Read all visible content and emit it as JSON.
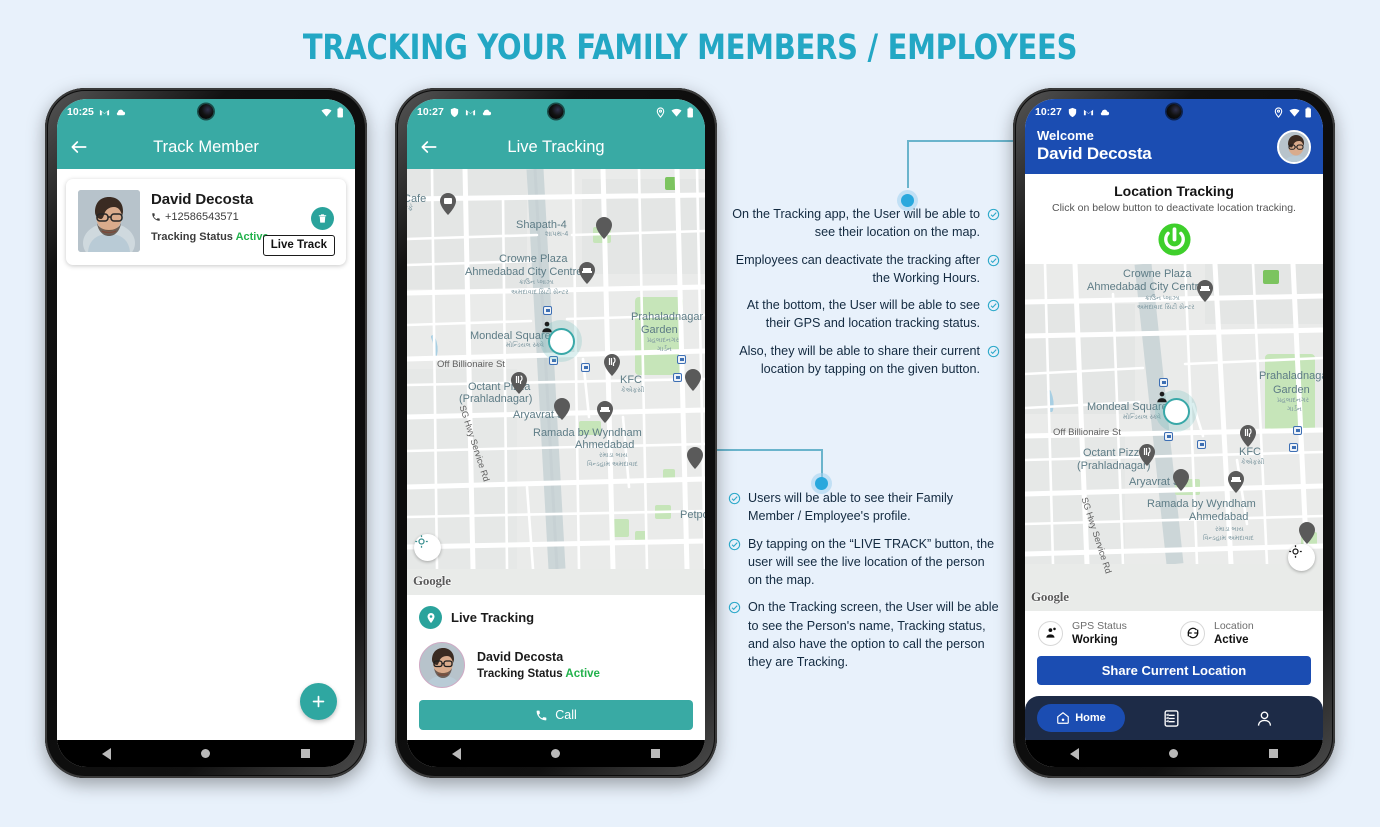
{
  "page": {
    "title": "TRACKING YOUR FAMILY MEMBERS / EMPLOYEES",
    "background_color": "#e8f1fb",
    "accent_teal": "#39aaa4",
    "accent_blue": "#1b4db2",
    "accent_green": "#22b24c",
    "connector_color": "#6ab4cc"
  },
  "phone1": {
    "status_bar": {
      "time": "10:25",
      "icons_left": [
        "gmail-icon",
        "cloud-icon"
      ],
      "icons_right": [
        "wifi-icon",
        "battery-icon"
      ]
    },
    "appbar": {
      "back": "back-arrow-icon",
      "title": "Track Member"
    },
    "member": {
      "name": "David Decosta",
      "phone": "+12586543571",
      "status_label": "Tracking Status",
      "status_value": "Active",
      "delete_icon": "trash-icon",
      "live_track_label": "Live Track"
    },
    "fab": {
      "icon": "plus-icon"
    }
  },
  "phone2": {
    "status_bar": {
      "time": "10:27",
      "icons_left": [
        "shield-icon",
        "gmail-icon",
        "cloud-icon"
      ],
      "icons_right": [
        "location-pin-icon",
        "wifi-icon",
        "battery-icon"
      ]
    },
    "appbar": {
      "back": "back-arrow-icon",
      "title": "Live Tracking"
    },
    "map": {
      "attribution": "Google",
      "labels": [
        "Cafe",
        "Shapath-4",
        "શાપથ-4",
        "Crowne Plaza",
        "Ahmedabad City Centre",
        "ક્રાઉન પ્લાઝા",
        "અમદાવાદ સિટી સેન્ટર",
        "Prahaladnagar",
        "Garden",
        "પ્રહલાદનગર",
        "ગાર્ડન",
        "Mondeal Square",
        "મોન્ડિયલ સ્ક્વે",
        "Off Billionaire St",
        "KFC",
        "કેએફસી",
        "Octant Pizza",
        "(Prahladnagar)",
        "Aryavrat 3",
        "Ramada by Wyndham",
        "Ahmedabad",
        "રમાડા બાય",
        "વિન્ડહામ અમદાવાદ",
        "SG Hwy Service Rd",
        "Petpo"
      ],
      "locate_button_icon": "crosshair-icon",
      "user_marker": "person-location-marker"
    },
    "card": {
      "header_icon": "location-pin-icon",
      "header_title": "Live Tracking",
      "person_name": "David Decosta",
      "status_label": "Tracking Status",
      "status_value": "Active",
      "call_label": "Call",
      "call_icon": "phone-call-icon"
    }
  },
  "phone3": {
    "status_bar": {
      "time": "10:27",
      "icons_left": [
        "shield-icon",
        "gmail-icon",
        "cloud-icon"
      ],
      "icons_right": [
        "location-pin-icon",
        "wifi-icon",
        "battery-icon"
      ]
    },
    "header": {
      "welcome": "Welcome",
      "name": "David Decosta",
      "avatar": "user-avatar"
    },
    "tracking": {
      "title": "Location Tracking",
      "subtitle": "Click on below button to deactivate location tracking.",
      "power_icon": "power-button-icon",
      "power_color": "#3ecf2b"
    },
    "map": {
      "attribution": "Google",
      "labels": [
        "Crowne Plaza",
        "Ahmedabad City Centre",
        "ક્રાઉન પ્લાઝા",
        "અમદાવાદ સિટી સેન્ટર",
        "Prahaladnagar",
        "Garden",
        "પ્રહલાદનગર",
        "ગાર્ડન",
        "Mondeal Square",
        "મોન્ડિયલ સ્ક્વે",
        "Off Billionaire St",
        "KFC",
        "કેએફસી",
        "Octant Pizza",
        "(Prahladnagar)",
        "Aryavrat 3",
        "Ramada by Wyndham",
        "Ahmedabad",
        "રમાડા બાય",
        "વિન્ડહામ અમદાવાદ",
        "SG Hwy Service Rd"
      ],
      "locate_button_icon": "crosshair-icon",
      "user_marker": "person-location-marker"
    },
    "status": {
      "gps": {
        "icon": "gps-user-icon",
        "label": "GPS Status",
        "value": "Working"
      },
      "location": {
        "icon": "sync-icon",
        "label": "Location",
        "value": "Active"
      }
    },
    "share_button": "Share Current Location",
    "bottom_nav": [
      {
        "icon": "home-icon",
        "label": "Home",
        "active": true
      },
      {
        "icon": "list-checklist-icon",
        "label": "",
        "active": false
      },
      {
        "icon": "person-icon",
        "label": "",
        "active": false
      }
    ]
  },
  "annotations": {
    "top": [
      "On the Tracking app, the User will be able to see their location on the map.",
      "Employees can deactivate the tracking after the Working Hours.",
      "At the bottom, the User will be able to see their GPS and location tracking status.",
      "Also, they will be able to share their current location by tapping on the given button."
    ],
    "bottom": [
      "Users will be able to see their Family Member / Employee's profile.",
      "By tapping on the “LIVE TRACK” button, the user will see the live location of the person on the map.",
      "On the Tracking screen, the User will be able to see the Person's name, Tracking status, and also have the option to call the person they are Tracking."
    ]
  }
}
